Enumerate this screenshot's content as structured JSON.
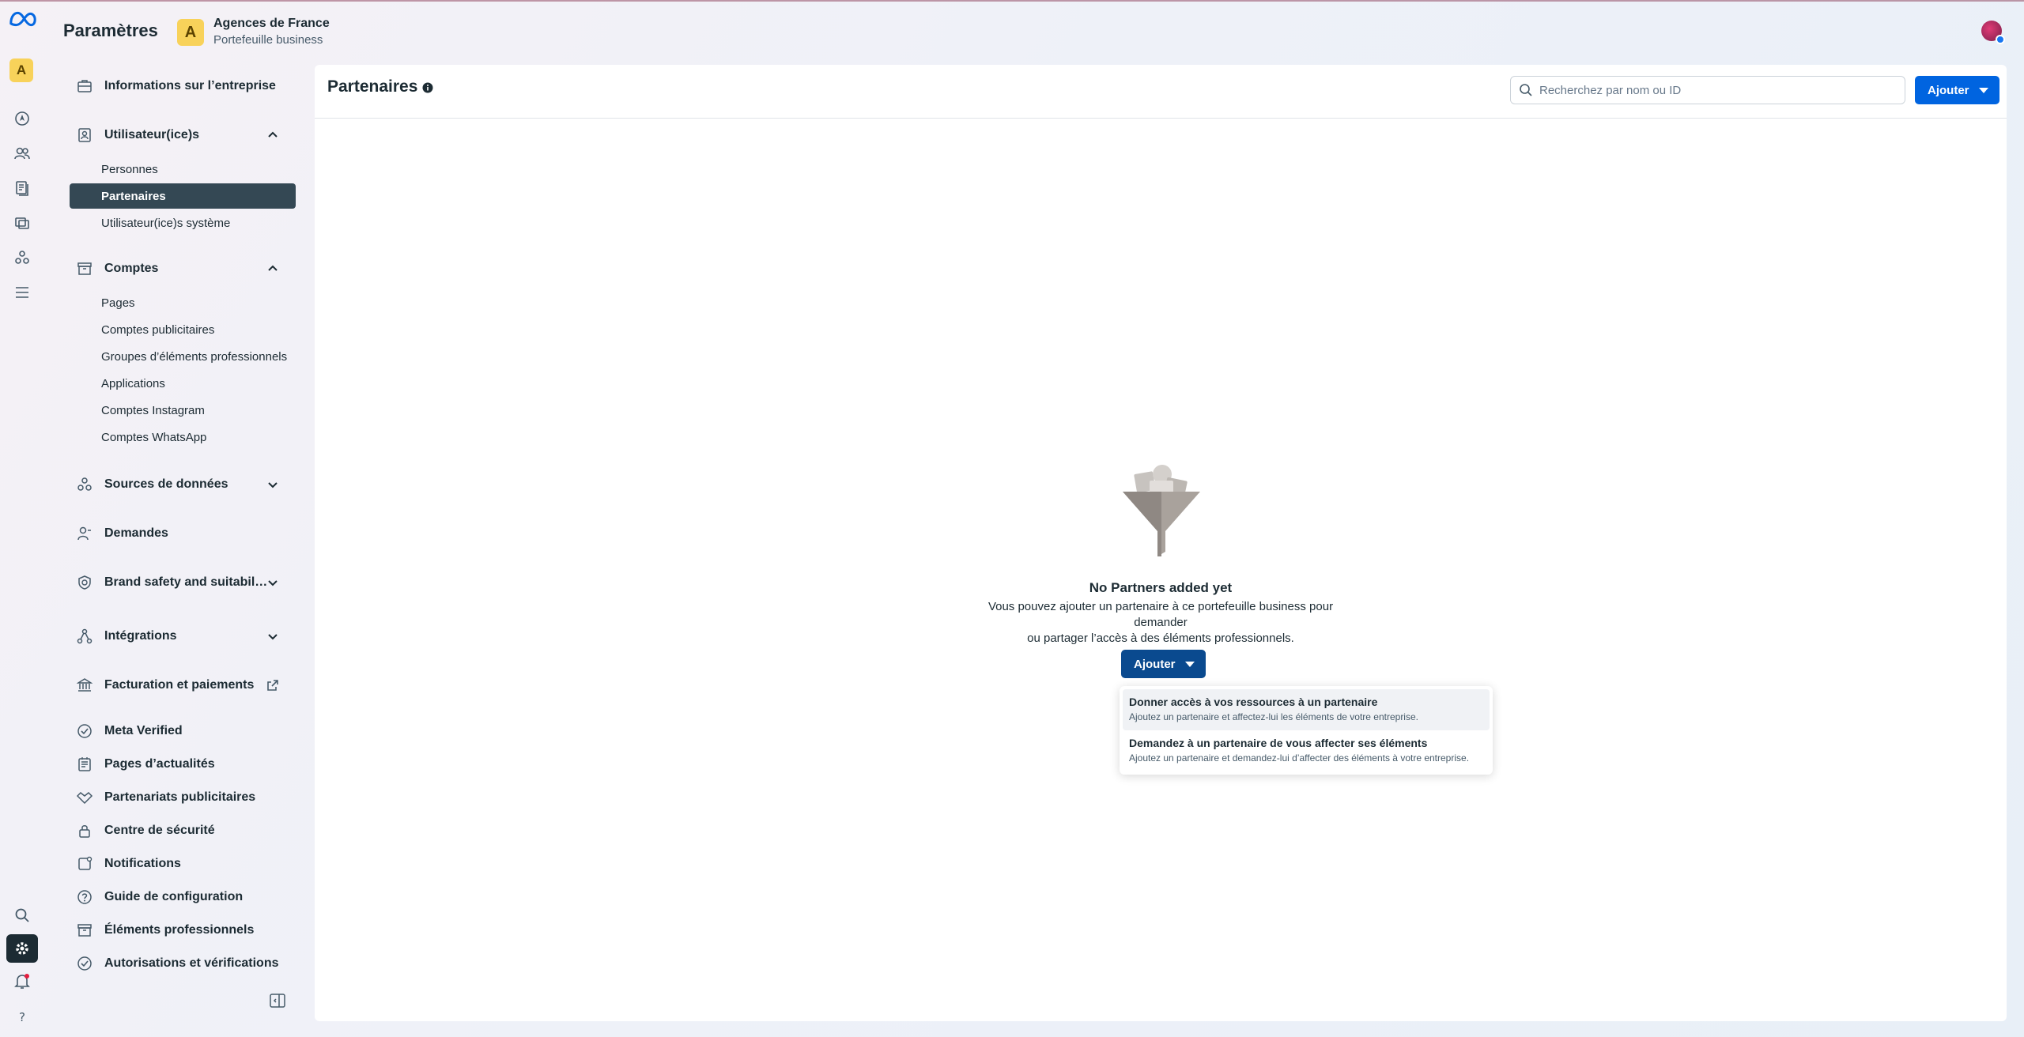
{
  "header": {
    "title": "Paramètres",
    "business_initial": "A",
    "business_name": "Agences de France",
    "business_subtitle": "Portefeuille business"
  },
  "rail": {
    "avatar_initial": "A",
    "icons": [
      "meta-logo",
      "home-icon",
      "people-icon",
      "pages-icon",
      "ads-icon",
      "data-sources-icon",
      "menu-icon",
      "search-icon",
      "settings-icon",
      "notifications-icon",
      "help-icon"
    ]
  },
  "sidebar": {
    "business_info": "Informations sur l’entreprise",
    "users": {
      "label": "Utilisateur(ice)s",
      "items": [
        "Personnes",
        "Partenaires",
        "Utilisateur(ice)s système"
      ],
      "active": "Partenaires"
    },
    "accounts": {
      "label": "Comptes",
      "items": [
        "Pages",
        "Comptes publicitaires",
        "Groupes d’éléments professionnels",
        "Applications",
        "Comptes Instagram",
        "Comptes WhatsApp"
      ]
    },
    "data_sources": "Sources de données",
    "requests": "Demandes",
    "brand_safety": "Brand safety and suitabil…",
    "integrations": "Intégrations",
    "billing": "Facturation et paiements",
    "meta_verified": "Meta Verified",
    "news_pages": "Pages d’actualités",
    "ad_partnerships": "Partenariats publicitaires",
    "security_center": "Centre de sécurité",
    "notifications": "Notifications",
    "setup_guide": "Guide de configuration",
    "business_assets": "Éléments professionnels",
    "permissions": "Autorisations et vérifications"
  },
  "main": {
    "title": "Partenaires",
    "search_placeholder": "Recherchez par nom ou ID",
    "add_label": "Ajouter",
    "empty_title": "No Partners added yet",
    "empty_desc_line1": "Vous pouvez ajouter un partenaire à ce portefeuille business pour demander",
    "empty_desc_line2": "ou partager l’accès à des éléments professionnels.",
    "empty_add_label": "Ajouter"
  },
  "dropdown": {
    "items": [
      {
        "title": "Donner accès à vos ressources à un partenaire",
        "desc": "Ajoutez un partenaire et affectez-lui les éléments de votre entreprise."
      },
      {
        "title": "Demandez à un partenaire de vous affecter ses éléments",
        "desc": "Ajoutez un partenaire et demandez-lui d’affecter des éléments à votre entreprise."
      }
    ]
  },
  "colors": {
    "primary": "#0064e0",
    "primary_dark": "#0a4a8f",
    "active_nav": "#344854",
    "avatar": "#f8d25a"
  }
}
